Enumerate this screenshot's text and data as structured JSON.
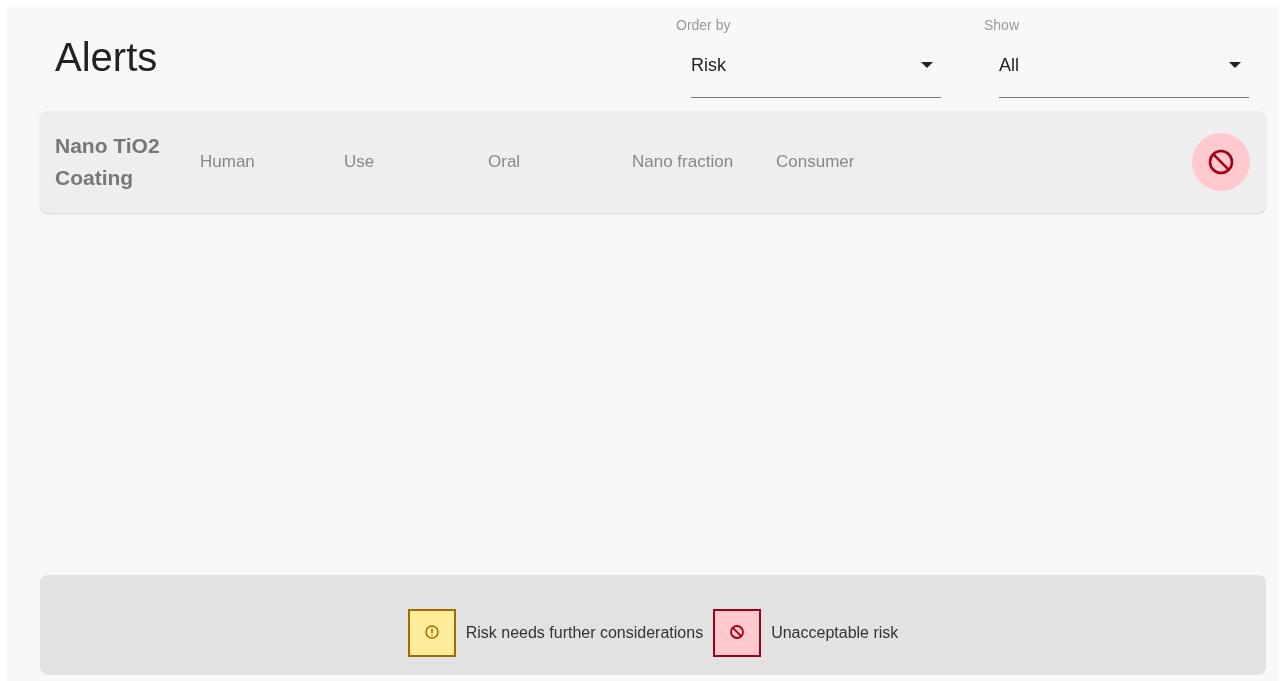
{
  "title": "Alerts",
  "filters": [
    {
      "label": "Order by",
      "value": "Risk"
    },
    {
      "label": "Show",
      "value": "All"
    }
  ],
  "alerts": [
    {
      "name": "Nano TiO2 Coating",
      "fields": [
        "Human",
        "Use",
        "Oral",
        "Nano fraction",
        "Consumer"
      ],
      "kind": "unacceptable"
    }
  ],
  "legend": [
    {
      "kind": "warning",
      "label": "Risk needs further considerations"
    },
    {
      "kind": "unacceptable",
      "label": "Unacceptable risk"
    }
  ]
}
